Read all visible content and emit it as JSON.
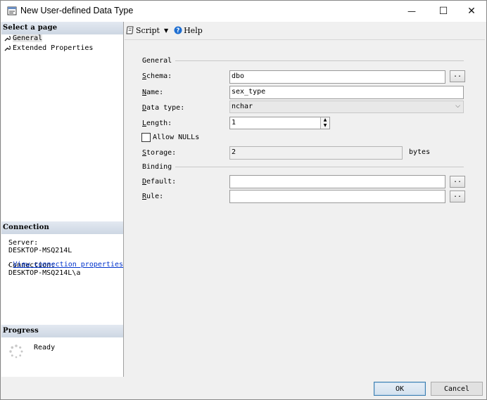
{
  "window": {
    "title": "New User-defined Data Type",
    "minimize": "—",
    "maximize": "☐",
    "close": "✕"
  },
  "left_pane": {
    "select_page_header": "Select a page",
    "pages": [
      {
        "label": "General",
        "icon": "wrench-icon",
        "selected": true
      },
      {
        "label": "Extended Properties",
        "icon": "wrench-icon",
        "selected": false
      }
    ],
    "connection_header": "Connection",
    "server_label": "Server:",
    "server_value": "DESKTOP-MSQ214L",
    "connection_label": "Connection:",
    "connection_value": "DESKTOP-MSQ214L\\a",
    "view_connection_link": "View connection properties",
    "progress_header": "Progress",
    "progress_status": "Ready"
  },
  "toolbar": {
    "script_label": "Script",
    "help_label": "Help"
  },
  "form": {
    "general_title": "General",
    "schema_label": "Schema:",
    "schema_value": "dbo",
    "name_label": "Name:",
    "name_value": "sex_type",
    "datatype_label": "Data type:",
    "datatype_value": "nchar",
    "length_label": "Length:",
    "length_value": "1",
    "allow_nulls_label": "Allow NULLs",
    "allow_nulls_checked": false,
    "storage_label": "Storage:",
    "storage_value": "2",
    "storage_unit": "bytes",
    "binding_title": "Binding",
    "default_label": "Default:",
    "default_value": "",
    "rule_label": "Rule:",
    "rule_value": "",
    "browse_label": ".."
  },
  "buttons": {
    "ok": "OK",
    "cancel": "Cancel"
  },
  "colors": {
    "header_gradient": "#cdd7e3",
    "link": "#0033cc",
    "ok_border": "#3c7fb1"
  }
}
